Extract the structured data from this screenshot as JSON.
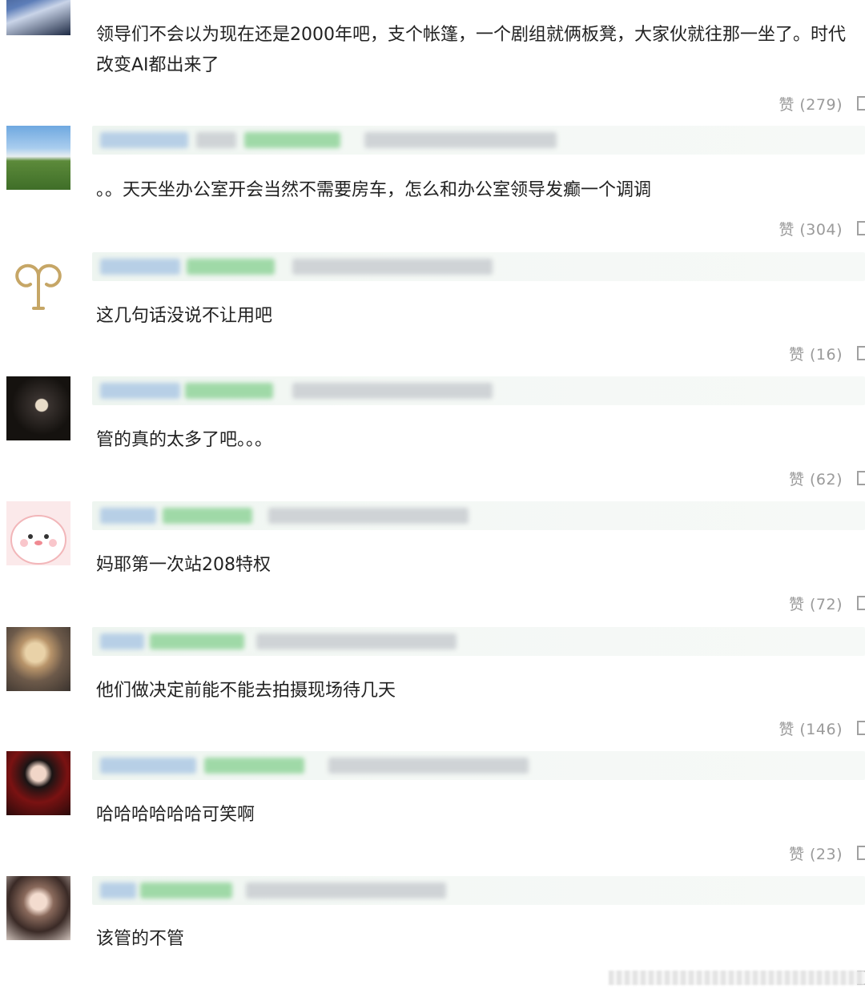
{
  "comments": [
    {
      "text": "领导们不会以为现在还是2000年吧，支个帐篷，一个剧组就俩板凳，大家伙就往那一坐了。时代\n改变AI都出来了",
      "likes": "赞 (279)",
      "avatar": "singer-photo-avatar"
    },
    {
      "text": "。。天天坐办公室开会当然不需要房车，怎么和办公室领导发癫一个调调",
      "likes": "赞 (304)",
      "avatar": "landscape-photo-avatar"
    },
    {
      "text": "这几句话没说不让用吧",
      "likes": "赞 (16)",
      "avatar": "gold-symbol-avatar"
    },
    {
      "text": "管的真的太多了吧。。。",
      "likes": "赞 (62)",
      "avatar": "night-photo-avatar"
    },
    {
      "text": "妈耶第一次站208特权",
      "likes": "赞 (72)",
      "avatar": "pink-cartoon-avatar"
    },
    {
      "text": "他们做决定前能不能去拍摄现场待几天",
      "likes": "赞 (146)",
      "avatar": "illustration-avatar"
    },
    {
      "text": "哈哈哈哈哈哈可笑啊",
      "likes": "赞 (23)",
      "avatar": "red-portrait-avatar"
    },
    {
      "text": "该管的不管",
      "likes": "",
      "avatar": "woman-portrait-avatar"
    }
  ],
  "colors": {
    "header_bg": "#eef5f0",
    "badge": "#9fd9a7",
    "name": "#b7cfe6",
    "like_text": "#9a9a9a"
  }
}
